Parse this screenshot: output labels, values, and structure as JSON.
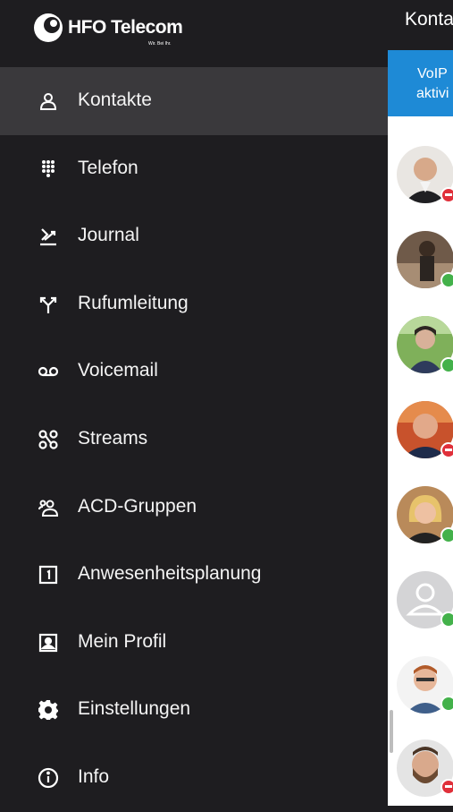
{
  "brand": {
    "name": "HFO Telecom",
    "tagline": "Wir. Bei Ihr."
  },
  "menu": {
    "items": [
      {
        "label": "Kontakte",
        "icon": "person-icon",
        "active": true
      },
      {
        "label": "Telefon",
        "icon": "dialpad-icon",
        "active": false
      },
      {
        "label": "Journal",
        "icon": "journal-icon",
        "active": false
      },
      {
        "label": "Rufumleitung",
        "icon": "call-forward-icon",
        "active": false
      },
      {
        "label": "Voicemail",
        "icon": "voicemail-icon",
        "active": false
      },
      {
        "label": "Streams",
        "icon": "streams-icon",
        "active": false
      },
      {
        "label": "ACD-Gruppen",
        "icon": "group-icon",
        "active": false
      },
      {
        "label": "Anwesenheitsplanung",
        "icon": "calendar-icon",
        "active": false
      },
      {
        "label": "Mein Profil",
        "icon": "profile-icon",
        "active": false
      },
      {
        "label": "Einstellungen",
        "icon": "gear-icon",
        "active": false
      },
      {
        "label": "Info",
        "icon": "info-icon",
        "active": false
      }
    ]
  },
  "background_screen": {
    "title": "Kontakte",
    "banner_line1": "VoIP",
    "banner_line2": "aktivi",
    "contacts": [
      {
        "status": "red"
      },
      {
        "status": "green"
      },
      {
        "status": "green"
      },
      {
        "status": "red"
      },
      {
        "status": "green"
      },
      {
        "status": "green"
      },
      {
        "status": "green"
      },
      {
        "status": "red"
      }
    ]
  },
  "colors": {
    "drawer_bg": "#1e1d20",
    "active_item_bg": "#3a393c",
    "banner_blue": "#1e8ad6",
    "status_green": "#43b14a",
    "status_red": "#e0303a"
  }
}
